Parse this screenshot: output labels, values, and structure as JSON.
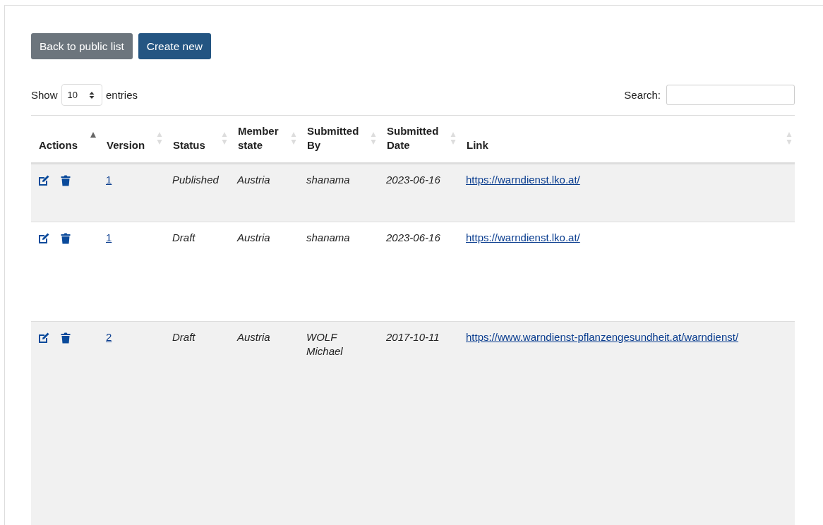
{
  "buttons": [
    {
      "label": "Back to public list",
      "kind": "secondary"
    },
    {
      "label": "Create new",
      "kind": "primary"
    }
  ],
  "length_control": {
    "prefix": "Show",
    "value": "10",
    "suffix": "entries"
  },
  "search": {
    "label": "Search:"
  },
  "table": {
    "columns": [
      {
        "label": "Actions",
        "sorted": true
      },
      {
        "label": "Version",
        "sorted": false
      },
      {
        "label": "Status",
        "sorted": false
      },
      {
        "label": "Member state",
        "sorted": false
      },
      {
        "label": "Submitted By",
        "sorted": false
      },
      {
        "label": "Submitted Date",
        "sorted": false
      },
      {
        "label": "Link",
        "sorted": false
      }
    ],
    "rows": [
      {
        "version": "1",
        "status": "Published",
        "member_state": "Austria",
        "submitted_by": "shanama",
        "submitted_date": "2023-06-16",
        "link": "https://warndienst.lko.at/"
      },
      {
        "version": "1",
        "status": "Draft",
        "member_state": "Austria",
        "submitted_by": "shanama",
        "submitted_date": "2023-06-16",
        "link": "https://warndienst.lko.at/"
      },
      {
        "version": "2",
        "status": "Draft",
        "member_state": "Austria",
        "submitted_by": "WOLF Michael",
        "submitted_date": "2017-10-11",
        "link": "https://www.warndienst-pflanzengesundheit.at/warndienst/"
      }
    ]
  }
}
